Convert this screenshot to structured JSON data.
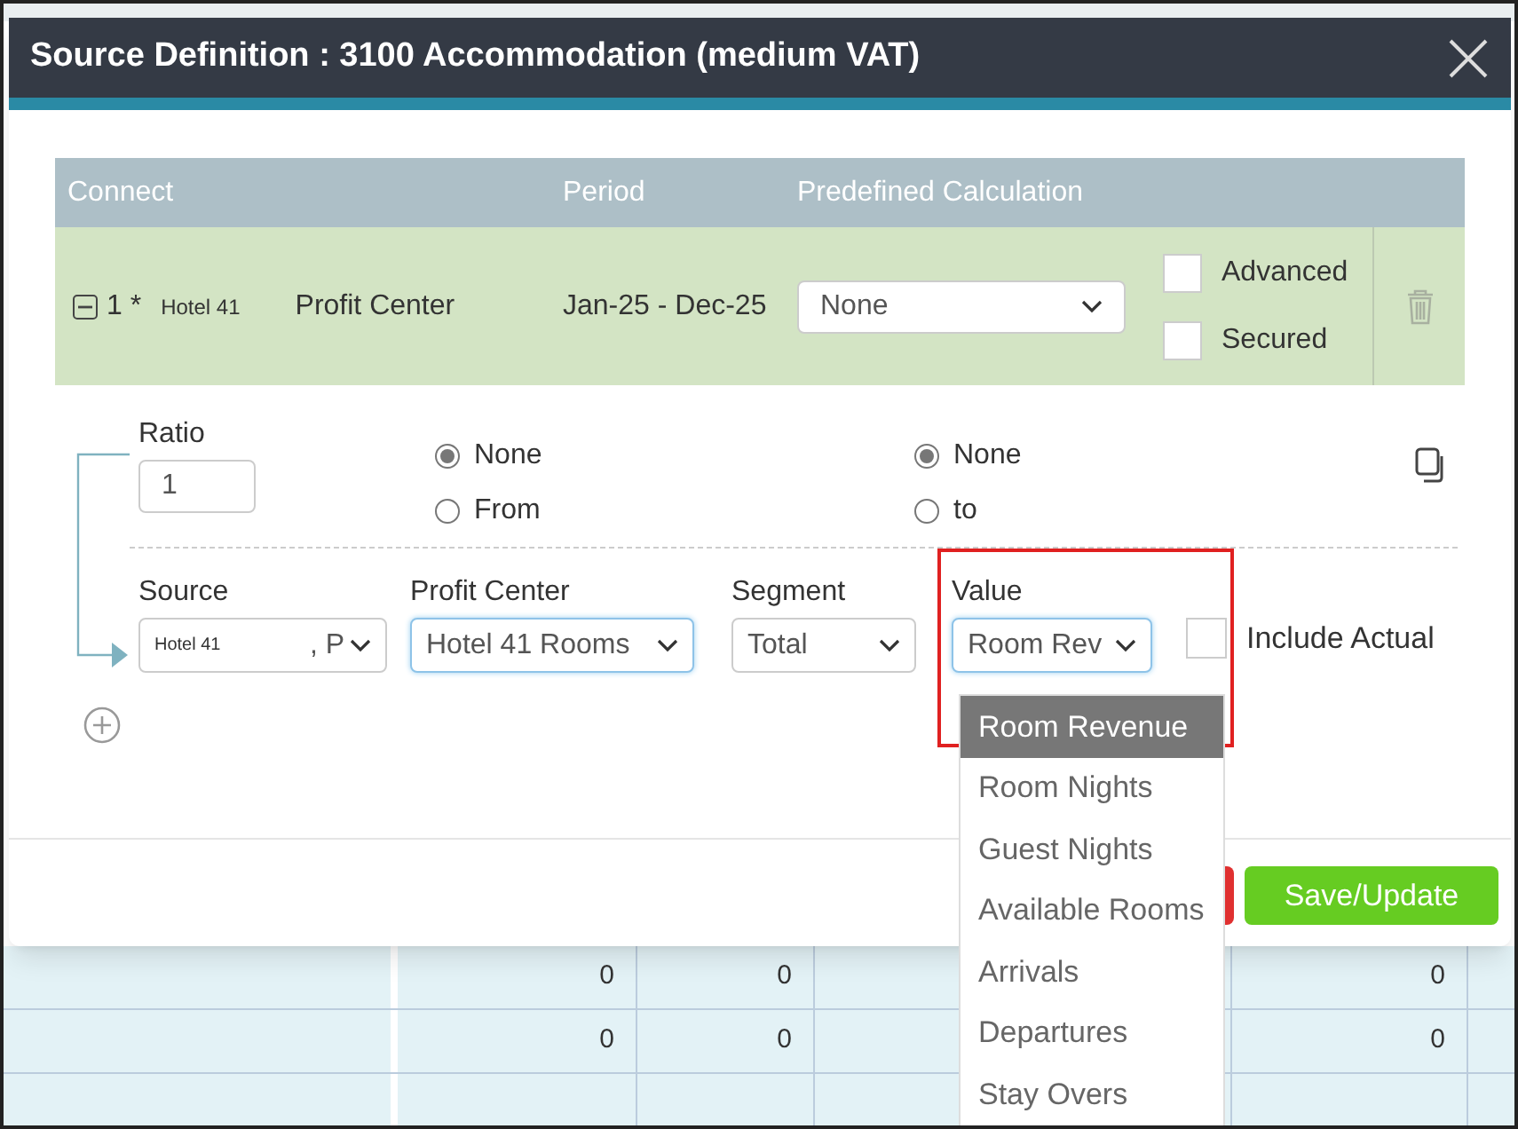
{
  "dialog": {
    "title": "Source Definition : 3100 Accommodation (medium VAT)"
  },
  "connect_table": {
    "columns": [
      "Connect",
      "Period",
      "Predefined Calculation"
    ],
    "rows": [
      {
        "expanded": true,
        "number": "1 *",
        "source": "Hotel 41",
        "dimension": "Profit Center",
        "period": "Jan-25 - Dec-25",
        "predefined_calculation": "None",
        "advanced": false,
        "secured": false,
        "advanced_label": "Advanced",
        "secured_label": "Secured"
      }
    ]
  },
  "ratio": {
    "label": "Ratio",
    "value": "1"
  },
  "from_options": [
    {
      "label": "None",
      "selected": true
    },
    {
      "label": "From",
      "selected": false
    }
  ],
  "to_options": [
    {
      "label": "None",
      "selected": true
    },
    {
      "label": "to",
      "selected": false
    }
  ],
  "fields": [
    {
      "label": "Source",
      "value": "Hotel 41",
      "suffix": ", P",
      "focused": false
    },
    {
      "label": "Profit Center",
      "value": "Hotel 41 Rooms",
      "focused": true
    },
    {
      "label": "Segment",
      "value": "Total",
      "focused": false
    },
    {
      "label": "Value",
      "value": "Room Rev",
      "focused": true
    }
  ],
  "include_actual": {
    "label": "Include Actual",
    "checked": false
  },
  "value_options": [
    {
      "label": "Room Revenue",
      "selected": true
    },
    {
      "label": "Room Nights",
      "selected": false
    },
    {
      "label": "Guest Nights",
      "selected": false
    },
    {
      "label": "Available Rooms",
      "selected": false
    },
    {
      "label": "Arrivals",
      "selected": false
    },
    {
      "label": "Departures",
      "selected": false
    },
    {
      "label": "Stay Overs",
      "selected": false
    }
  ],
  "buttons": [
    "Save/Update"
  ],
  "background_table": {
    "rows": [
      [
        "0",
        "0",
        "0"
      ],
      [
        "0",
        "0",
        "0"
      ]
    ]
  }
}
